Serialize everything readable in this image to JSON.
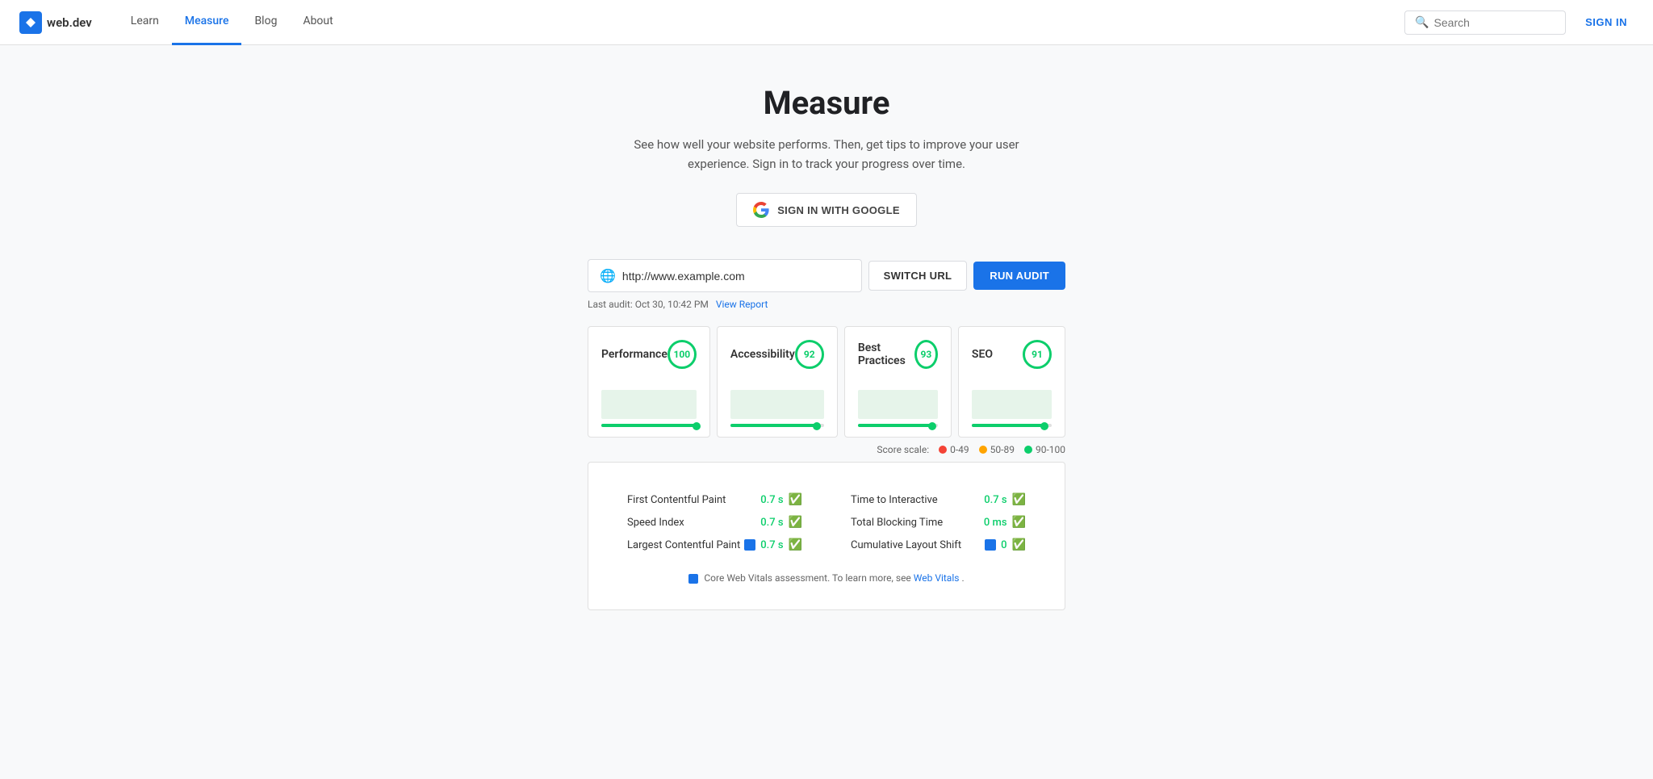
{
  "navbar": {
    "logo_text": "web.dev",
    "nav_items": [
      {
        "label": "Learn",
        "active": false
      },
      {
        "label": "Measure",
        "active": true
      },
      {
        "label": "Blog",
        "active": false
      },
      {
        "label": "About",
        "active": false
      }
    ],
    "search_placeholder": "Search",
    "sign_in_label": "SIGN IN"
  },
  "page": {
    "title": "Measure",
    "subtitle": "See how well your website performs. Then, get tips to improve your user experience. Sign in to track your progress over time.",
    "google_signin_label": "SIGN IN WITH GOOGLE"
  },
  "url_section": {
    "url_value": "http://www.example.com",
    "switch_url_label": "SWITCH URL",
    "run_audit_label": "RUN AUDIT",
    "last_audit_prefix": "Last audit: Oct 30, 10:42 PM",
    "view_report_label": "View Report"
  },
  "scores": [
    {
      "label": "Performance",
      "value": "100",
      "fill_pct": 100
    },
    {
      "label": "Accessibility",
      "value": "92",
      "fill_pct": 92
    },
    {
      "label": "Best Practices",
      "value": "93",
      "fill_pct": 93
    },
    {
      "label": "SEO",
      "value": "91",
      "fill_pct": 91
    }
  ],
  "score_scale": {
    "label": "Score scale:",
    "items": [
      {
        "label": "0-49",
        "color": "#f44336"
      },
      {
        "label": "50-89",
        "color": "#ffa400"
      },
      {
        "label": "90-100",
        "color": "#0cce6b"
      }
    ]
  },
  "metrics": {
    "left": [
      {
        "name": "First Contentful Paint",
        "value": "0.7 s",
        "has_badge": false
      },
      {
        "name": "Speed Index",
        "value": "0.7 s",
        "has_badge": false
      },
      {
        "name": "Largest Contentful Paint",
        "value": "0.7 s",
        "has_badge": true
      }
    ],
    "right": [
      {
        "name": "Time to Interactive",
        "value": "0.7 s",
        "has_badge": false
      },
      {
        "name": "Total Blocking Time",
        "value": "0 ms",
        "has_badge": false
      },
      {
        "name": "Cumulative Layout Shift",
        "value": "0",
        "has_badge": true
      }
    ],
    "note": "Core Web Vitals assessment. To learn more, see ",
    "web_vitals_label": "Web Vitals",
    "web_vitals_url": "#"
  }
}
